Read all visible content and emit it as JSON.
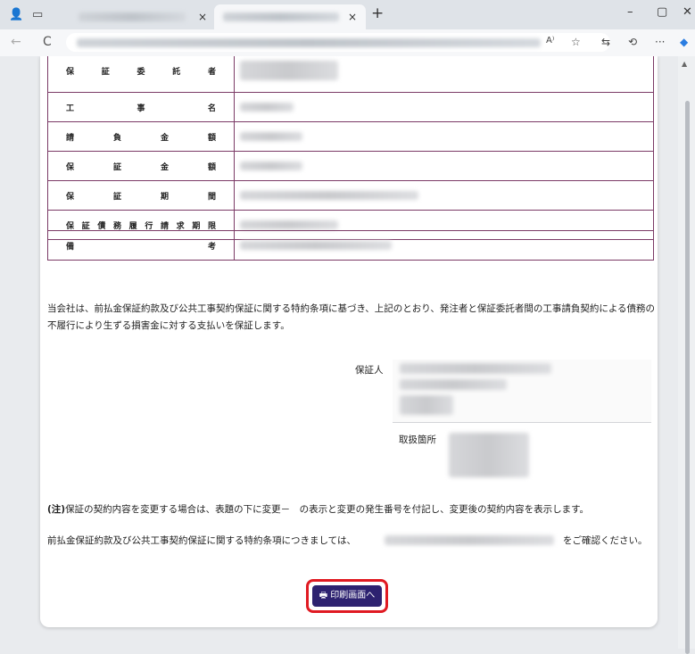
{
  "browser": {
    "tab_close_glyph": "×",
    "new_tab_glyph": "+",
    "window_controls": [
      "–",
      "▢",
      "✕"
    ],
    "nav": {
      "back": "←",
      "reload": "C"
    },
    "toolbar_icons": [
      "read-aloud-icon",
      "favorite-star-icon",
      "favorites-list-icon",
      "history-icon",
      "more-icon",
      "copilot-icon"
    ],
    "toolbar_glyphs": [
      "A⁾",
      "☆",
      "⇆",
      "⟲",
      "···",
      "◆"
    ]
  },
  "form": {
    "rows": [
      {
        "label": "保証委託者"
      },
      {
        "label": "工事名"
      },
      {
        "label": "請負金額"
      },
      {
        "label": "保証金額"
      },
      {
        "label": "保証期間"
      },
      {
        "label": "保証債務履行請求期限"
      }
    ],
    "remarks_label": "備考"
  },
  "notice_text": "当会社は、前払金保証約款及び公共工事契約保証に関する特約条項に基づき、上記のとおり、発注者と保証委託者間の工事請負契約による債務の不履行により生ずる損害金に対する支払いを保証します。",
  "guarantor_label": "保証人",
  "handling_office_label": "取扱箇所",
  "note_prefix": "(注)",
  "note_text": "保証の契約内容を変更する場合は、表題の下に変更－　の表示と変更の発生番号を付記し、変更後の契約内容を表示します。",
  "clause_prefix": "前払金保証約款及び公共工事契約保証に関する特約条項につきましては、",
  "clause_suffix": "をご確認ください。",
  "print_button": {
    "icon": "printer-icon",
    "label": "印刷画面へ"
  },
  "colors": {
    "table_border": "#7b3a66",
    "button_bg": "#2d2270",
    "highlight": "#e01a22"
  }
}
